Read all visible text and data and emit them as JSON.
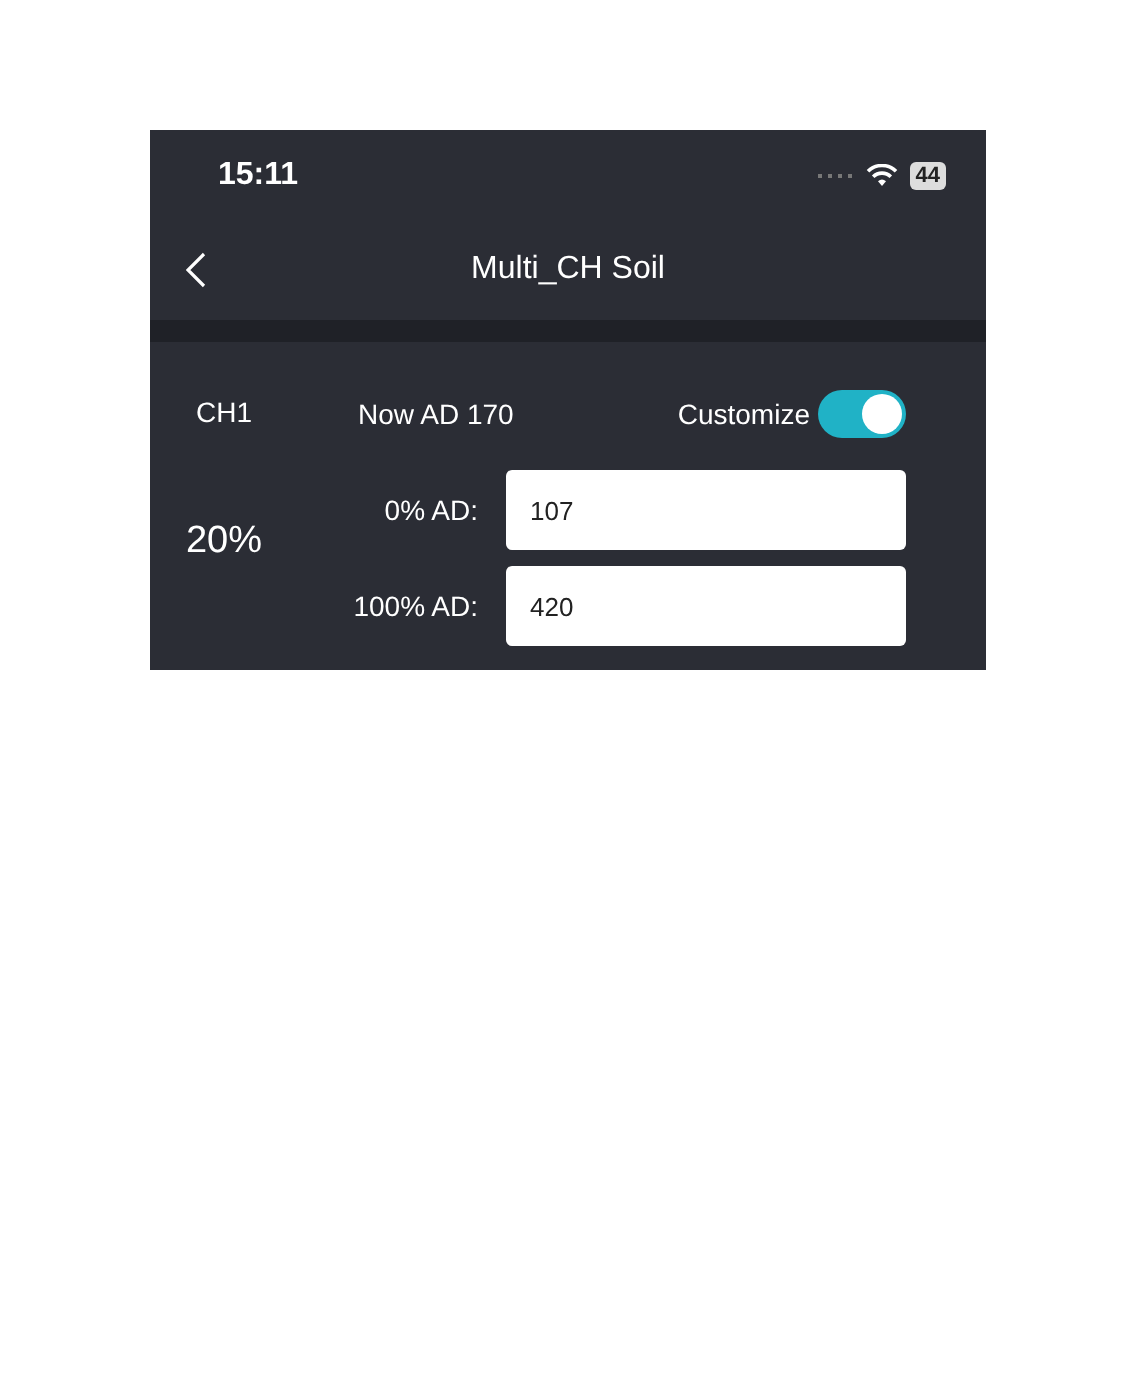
{
  "status_bar": {
    "time": "15:11",
    "battery": "44"
  },
  "nav": {
    "title": "Multi_CH Soil"
  },
  "channel": {
    "name": "CH1",
    "now": "Now AD 170",
    "customize": {
      "label": "Customize",
      "on": true
    },
    "percent": "20%",
    "fields": [
      {
        "label": "0% AD:",
        "value": "107"
      },
      {
        "label": "100% AD:",
        "value": "420"
      }
    ]
  }
}
